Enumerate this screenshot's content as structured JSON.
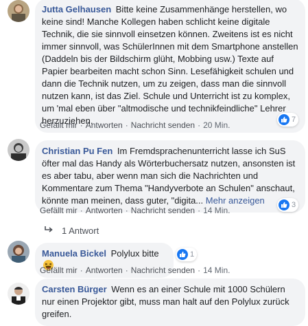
{
  "comments": [
    {
      "author": "Jutta Gelhausen",
      "text": "Bitte keine Zusammenhänge herstellen, wo keine sind! Manche Kollegen haben schlicht keine digitale Technik, die sie sinnvoll einsetzen können. Zweitens ist es nicht immer sinnvoll, was SchülerInnen mit dem Smartphone anstellen (Daddeln bis der Bildschirm glüht, Mobbing usw.) Texte auf Papier bearbeiten macht schon Sinn. Lesefähigkeit schulen und dann die Technik nutzen, um zu zeigen, dass man die sinnvoll nutzen kann, ist das Ziel. Schule und Unterricht ist zu komplex, um 'mal eben über \"altmodische und technikfeindliche\" Lehrer herzuziehen.",
      "actions": {
        "like": "Gefällt mir",
        "reply": "Antworten",
        "message": "Nachricht senden",
        "time": "20 Min."
      },
      "reactions": "7"
    },
    {
      "author": "Christian Pu Fen",
      "text": "Im Fremdsprachenunterricht lasse ich SuS öfter mal das Handy als Wörterbuchersatz nutzen, ansonsten ist es aber tabu, aber wenn man sich die Nachrichten und Kommentare zum Thema \"Handyverbote an Schulen\" anschaut, könnte man meinen, dass guter, \"digita...",
      "more": "Mehr anzeigen",
      "actions": {
        "like": "Gefällt mir",
        "reply": "Antworten",
        "message": "Nachricht senden",
        "time": "14 Min."
      },
      "reactions": "3",
      "replies": "1 Antwort"
    },
    {
      "author": "Manuela Bickel",
      "text": "Polylux bitte",
      "actions": {
        "like": "Gefällt mir",
        "reply": "Antworten",
        "message": "Nachricht senden",
        "time": "14 Min."
      },
      "reactions": "1"
    },
    {
      "author": "Carsten Bürger",
      "text": "Wenn es an einer Schule mit 1000 Schülern nur einen Projektor gibt, muss man halt auf den Polylux zurück greifen."
    }
  ],
  "icons": {
    "like": "thumbs-up-icon",
    "reply_arrow": "reply-arrow-icon",
    "emoji": "laughing-emoji-icon"
  },
  "colors": {
    "author": "#385898",
    "bubble": "#f2f3f5",
    "like_badge": "#1877f2",
    "meta": "#606770"
  }
}
